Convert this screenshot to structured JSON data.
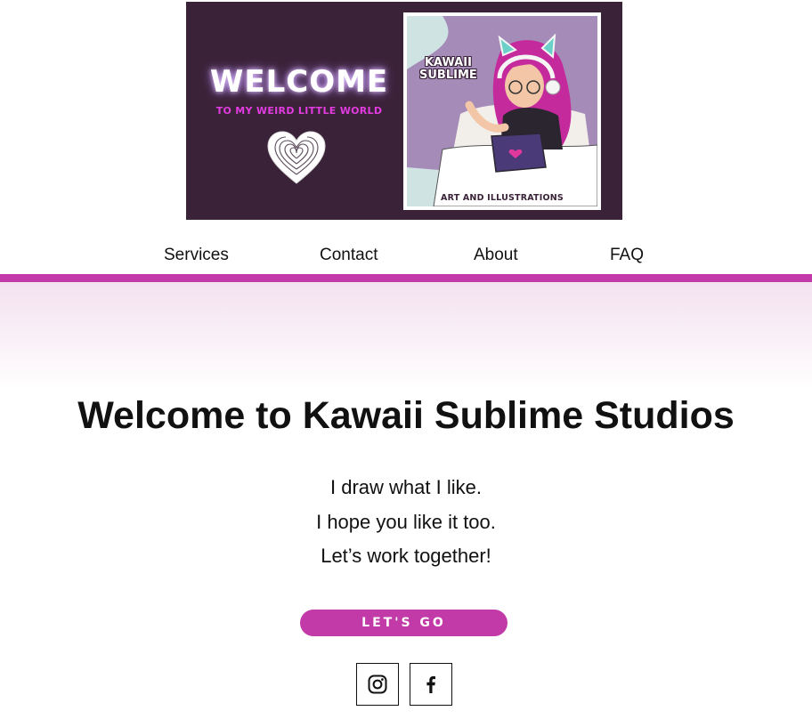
{
  "banner": {
    "welcome": "WELCOME",
    "subtitle": "TO MY WEIRD LITTLE WORLD",
    "art_brand_line1": "KAWAII",
    "art_brand_line2": "SUBLIME",
    "art_caption": "ART AND ILLUSTRATIONS"
  },
  "nav": {
    "items": [
      {
        "label": "Services"
      },
      {
        "label": "Contact"
      },
      {
        "label": "About"
      },
      {
        "label": "FAQ"
      }
    ]
  },
  "hero": {
    "title": "Welcome to Kawaii Sublime Studios",
    "lines": [
      "I draw what I like.",
      "I hope you like it too.",
      "Let’s work together!"
    ],
    "cta_label": "LET'S GO"
  },
  "social": {
    "icons": [
      "instagram-icon",
      "facebook-icon"
    ]
  },
  "colors": {
    "accent": "#c23aa8",
    "banner_bg": "#3a2238",
    "magenta_text": "#e23ce0"
  }
}
